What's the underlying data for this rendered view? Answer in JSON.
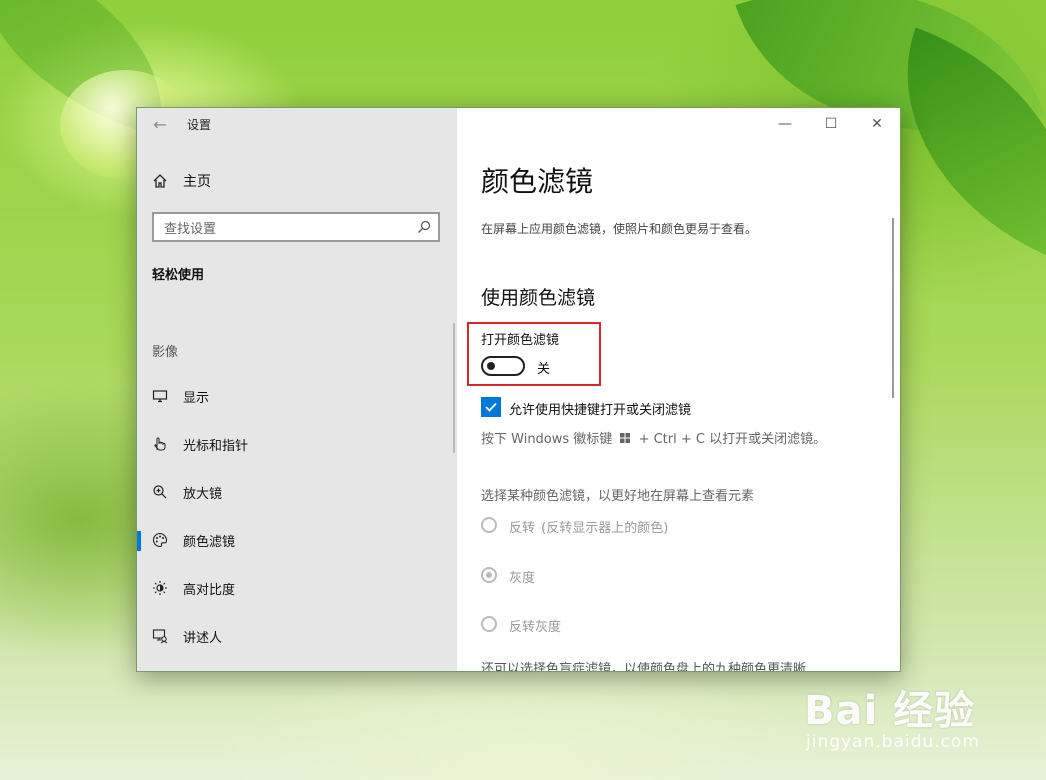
{
  "window": {
    "title": "设置",
    "controls": [
      "minimize",
      "maximize",
      "close"
    ]
  },
  "sidebar": {
    "home": "主页",
    "search_placeholder": "查找设置",
    "section_title": "轻松使用",
    "group_title": "影像",
    "items": [
      {
        "label": "显示",
        "icon": "monitor-icon",
        "active": false
      },
      {
        "label": "光标和指针",
        "icon": "pointer-icon",
        "active": false
      },
      {
        "label": "放大镜",
        "icon": "magnifier-icon",
        "active": false
      },
      {
        "label": "颜色滤镜",
        "icon": "palette-icon",
        "active": true
      },
      {
        "label": "高对比度",
        "icon": "contrast-icon",
        "active": false
      },
      {
        "label": "讲述人",
        "icon": "narrator-icon",
        "active": false
      }
    ]
  },
  "main": {
    "heading": "颜色滤镜",
    "description": "在屏幕上应用颜色滤镜，使照片和颜色更易于查看。",
    "subheading": "使用颜色滤镜",
    "toggle_label": "打开颜色滤镜",
    "toggle_state": "关",
    "toggle_on": false,
    "shortcut_checkbox_label": "允许使用快捷键打开或关闭滤镜",
    "shortcut_checked": true,
    "shortcut_hint_prefix": "按下 Windows 徽标键",
    "shortcut_hint_suffix": "+ Ctrl + C 以打开或关闭滤镜。",
    "choose_label": "选择某种颜色滤镜，以更好地在屏幕上查看元素",
    "filters": [
      {
        "label": "反转",
        "note": "(反转显示器上的颜色)",
        "selected": false
      },
      {
        "label": "灰度",
        "note": "",
        "selected": true
      },
      {
        "label": "反转灰度",
        "note": "",
        "selected": false
      }
    ],
    "more_text": "还可以选择色盲症滤镜，以使颜色盘上的九种颜色更清晰"
  },
  "colors": {
    "accent": "#0078d7",
    "highlight_box": "#d9262c"
  },
  "watermark": {
    "logo": "Bai 经验",
    "url": "jingyan.baidu.com"
  }
}
